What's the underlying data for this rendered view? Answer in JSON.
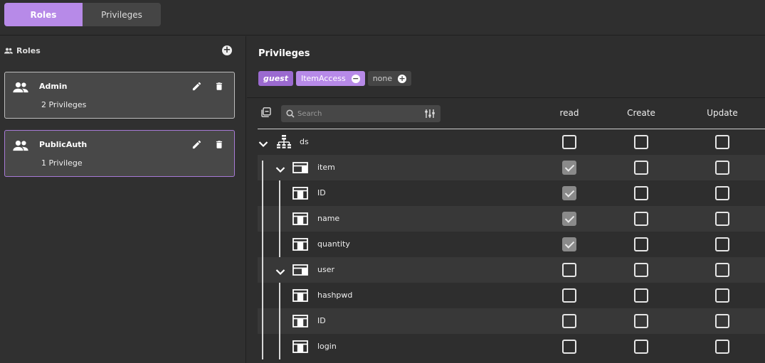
{
  "tabs": [
    {
      "label": "Roles",
      "active": true
    },
    {
      "label": "Privileges",
      "active": false
    }
  ],
  "left": {
    "header": "Roles",
    "roles": [
      {
        "name": "Admin",
        "privileges": "2 Privileges"
      },
      {
        "name": "PublicAuth",
        "privileges": "1 Privilege"
      }
    ]
  },
  "right": {
    "title": "Privileges",
    "chips": {
      "guest": "guest",
      "access": "ItemAccess",
      "none": "none"
    },
    "search_placeholder": "Search",
    "columns": [
      "read",
      "Create",
      "Update"
    ],
    "tree": [
      {
        "label": "ds",
        "icon": "datasource-icon",
        "read": false,
        "create": false,
        "update": false
      },
      {
        "label": "item",
        "icon": "table-icon",
        "read": true,
        "create": false,
        "update": false
      },
      {
        "label": "ID",
        "icon": "field-icon",
        "read": true,
        "create": false,
        "update": false
      },
      {
        "label": "name",
        "icon": "field-icon",
        "read": true,
        "create": false,
        "update": false
      },
      {
        "label": "quantity",
        "icon": "field-icon",
        "read": true,
        "create": false,
        "update": false
      },
      {
        "label": "user",
        "icon": "table-icon",
        "read": false,
        "create": false,
        "update": false
      },
      {
        "label": "hashpwd",
        "icon": "field-icon",
        "read": false,
        "create": false,
        "update": false
      },
      {
        "label": "ID",
        "icon": "field-icon",
        "read": false,
        "create": false,
        "update": false
      },
      {
        "label": "login",
        "icon": "field-icon",
        "read": false,
        "create": false,
        "update": false
      }
    ]
  },
  "colors": {
    "accent": "#b78ae8",
    "accent_dark": "#9b6ad0"
  }
}
